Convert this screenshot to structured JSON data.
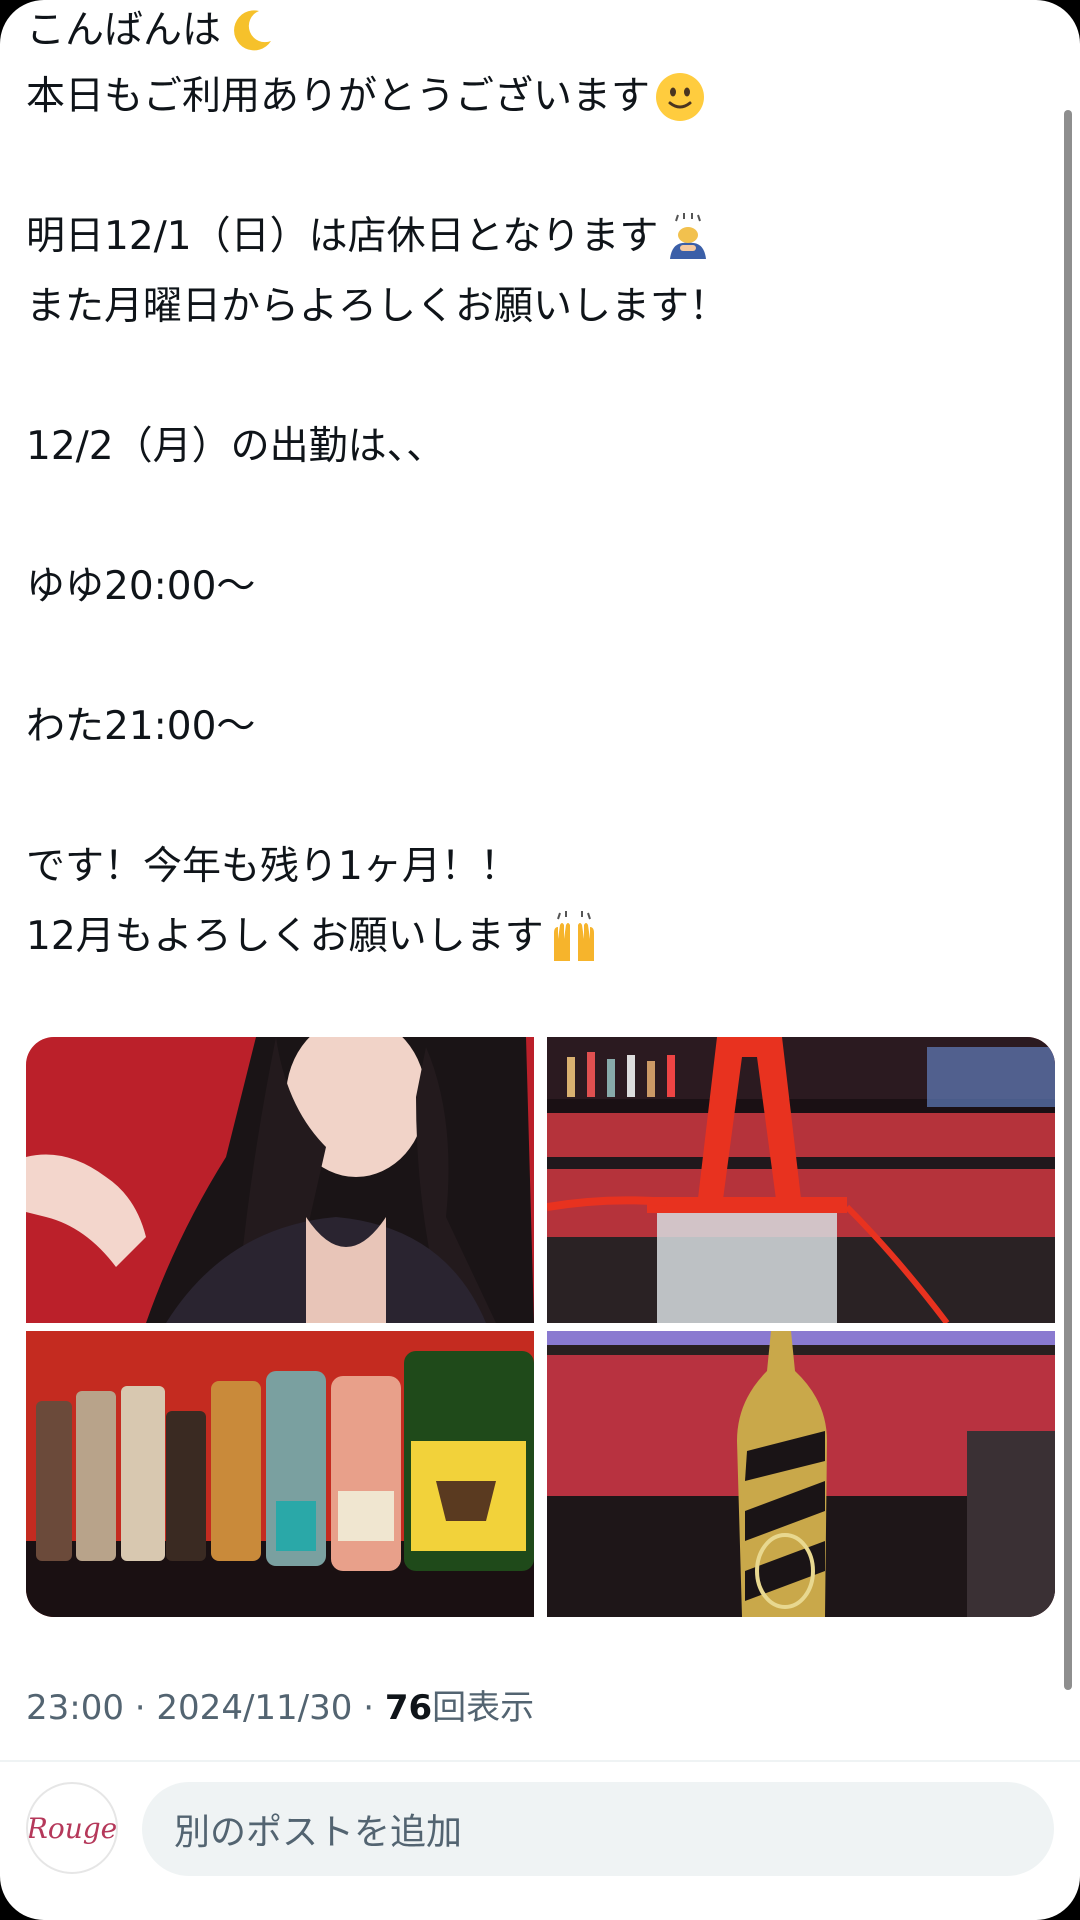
{
  "post": {
    "lines": [
      "こんばんは",
      "本日もご利用ありがとうございます",
      "",
      "明日12/1（日）は店休日となります",
      "また月曜日からよろしくお願いします！",
      "",
      "12/2（月）の出勤は、、",
      "",
      "ゆゆ20:00〜",
      "",
      "わた21:00〜",
      "",
      "です！今年も残り1ヶ月！！",
      "12月もよろしくお願いします"
    ],
    "emojis": {
      "line0": "crescent-moon-icon",
      "line1": "slightly-smiling-face-icon",
      "line3": "person-bowing-icon",
      "line13": "raising-hands-icon"
    }
  },
  "media": [
    {
      "name": "photo-woman-portrait"
    },
    {
      "name": "photo-bar-hookah"
    },
    {
      "name": "photo-whisky-bottles"
    },
    {
      "name": "photo-champagne-bottle"
    }
  ],
  "meta": {
    "time": "23:00",
    "separator": "·",
    "date": "2024/11/30",
    "views_count": "76",
    "views_label": "回表示"
  },
  "composer": {
    "avatar_text": "Rouge",
    "placeholder": "別のポストを追加"
  },
  "colors": {
    "text": "#0f1419",
    "secondary": "#536471",
    "input_bg": "#eff3f4"
  }
}
